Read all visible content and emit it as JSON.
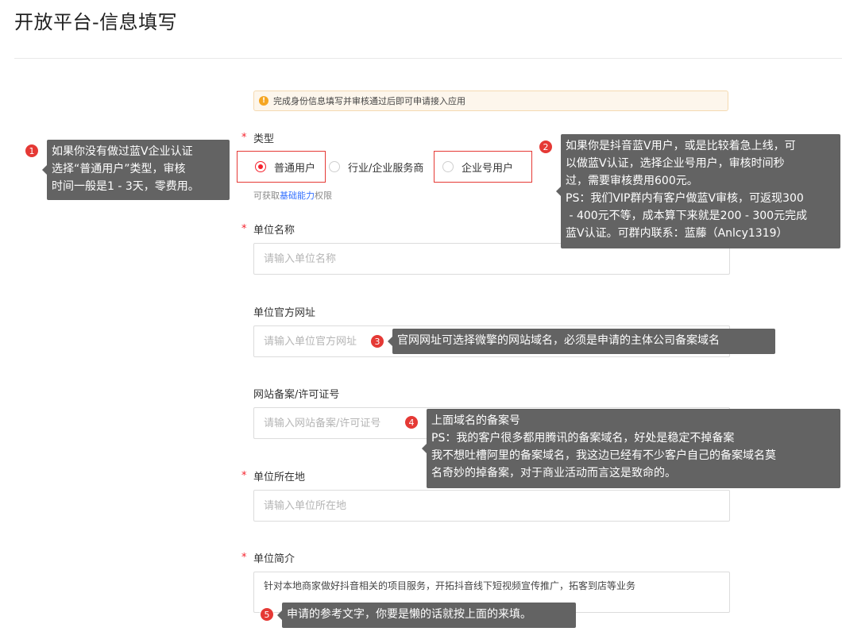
{
  "page": {
    "title": "开放平台-信息填写"
  },
  "notice": {
    "icon": "!",
    "text": "完成身份信息填写并审核通过后即可申请接入应用"
  },
  "type_field": {
    "required_mark": "*",
    "label": "类型",
    "options": [
      "普通用户",
      "行业/企业服务商",
      "企业号用户"
    ],
    "selected": "普通用户",
    "hint_prefix": "可获取",
    "hint_link": "基础能力",
    "hint_suffix": "权限"
  },
  "org_name": {
    "required_mark": "*",
    "label": "单位名称",
    "placeholder": "请输入单位名称"
  },
  "website": {
    "label": "单位官方网址",
    "placeholder": "请输入单位官方网址"
  },
  "icp": {
    "label": "网站备案/许可证号",
    "placeholder": "请输入网站备案/许可证号"
  },
  "location": {
    "required_mark": "*",
    "label": "单位所在地",
    "placeholder": "请输入单位所在地"
  },
  "intro": {
    "required_mark": "*",
    "label": "单位简介",
    "value": "针对本地商家做好抖音相关的项目服务，开拓抖音线下短视频宣传推广，拓客到店等业务"
  },
  "annotations": [
    {
      "num": "1",
      "text": "如果你没有做过蓝V企业认证\n选择“普通用户”类型，审核\n时间一般是1 - 3天，零费用。"
    },
    {
      "num": "2",
      "text": "如果你是抖音蓝V用户，或是比较着急上线，可\n以做蓝V认证，选择企业号用户，审核时间秒\n过，需要审核费用600元。\nPS：我们VIP群内有客户做蓝V审核，可返现300\n - 400元不等，成本算下来就是200 - 300元完成\n蓝V认证。可群内联系：蓝藤（Anlcy1319）"
    },
    {
      "num": "3",
      "text": "官网网址可选择微擎的网站域名，必须是申请的主体公司备案域名"
    },
    {
      "num": "4",
      "text": "上面域名的备案号\nPS：我的客户很多都用腾讯的备案域名，好处是稳定不掉备案\n我不想吐槽阿里的备案域名，我这边已经有不少客户自己的备案域名莫\n名奇妙的掉备案，对于商业活动而言这是致命的。"
    },
    {
      "num": "5",
      "text": "申请的参考文字，你要是懒的话就按上面的来填。"
    }
  ]
}
